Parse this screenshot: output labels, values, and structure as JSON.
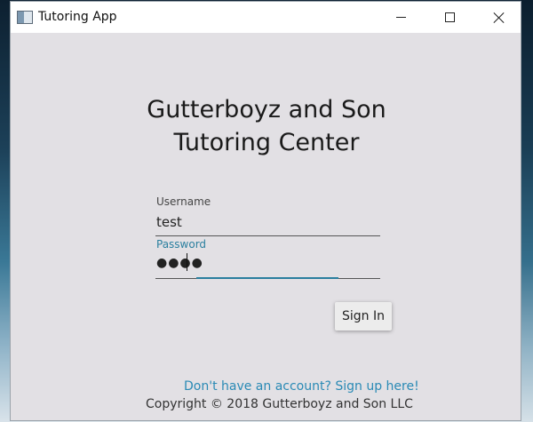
{
  "window": {
    "title": "Tutoring App",
    "icon": "app-window-icon",
    "controls": {
      "minimize": "minimize-icon",
      "maximize": "maximize-icon",
      "close": "close-icon"
    }
  },
  "heading": {
    "line1": "Gutterboyz and Son",
    "line2": "Tutoring Center"
  },
  "form": {
    "username": {
      "label": "Username",
      "value": "test"
    },
    "password": {
      "label": "Password",
      "value": "●●●●"
    },
    "sign_in_label": "Sign In"
  },
  "footer": {
    "signup_link": "Don't have an account? Sign up here!",
    "copyright": "Copyright © 2018 Gutterboyz and Son LLC"
  },
  "colors": {
    "accent": "#2a7f9f",
    "link": "#2a8ab5",
    "window_bg": "#e2e0e4"
  }
}
